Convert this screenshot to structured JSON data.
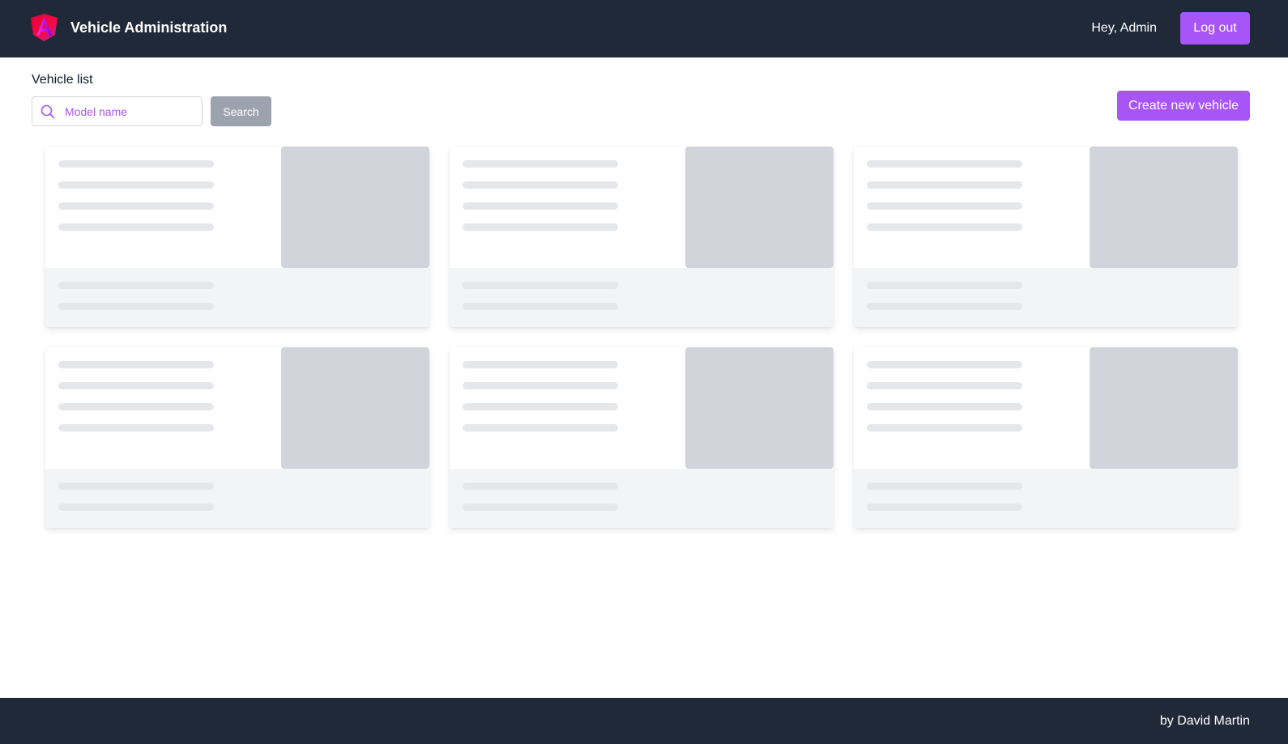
{
  "header": {
    "title": "Vehicle Administration",
    "greeting": "Hey, Admin",
    "logout_label": "Log out",
    "logo_icon": "angular-logo-icon"
  },
  "main": {
    "section_title": "Vehicle list",
    "search": {
      "placeholder": "Model name",
      "value": "",
      "button_label": "Search",
      "icon": "search-icon"
    },
    "create_label": "Create new vehicle",
    "cards_loading": 6
  },
  "footer": {
    "credit": "by David Martin"
  },
  "colors": {
    "accent": "#a855f7",
    "nav_bg": "#1f2937",
    "skeleton": "#d1d5db"
  }
}
